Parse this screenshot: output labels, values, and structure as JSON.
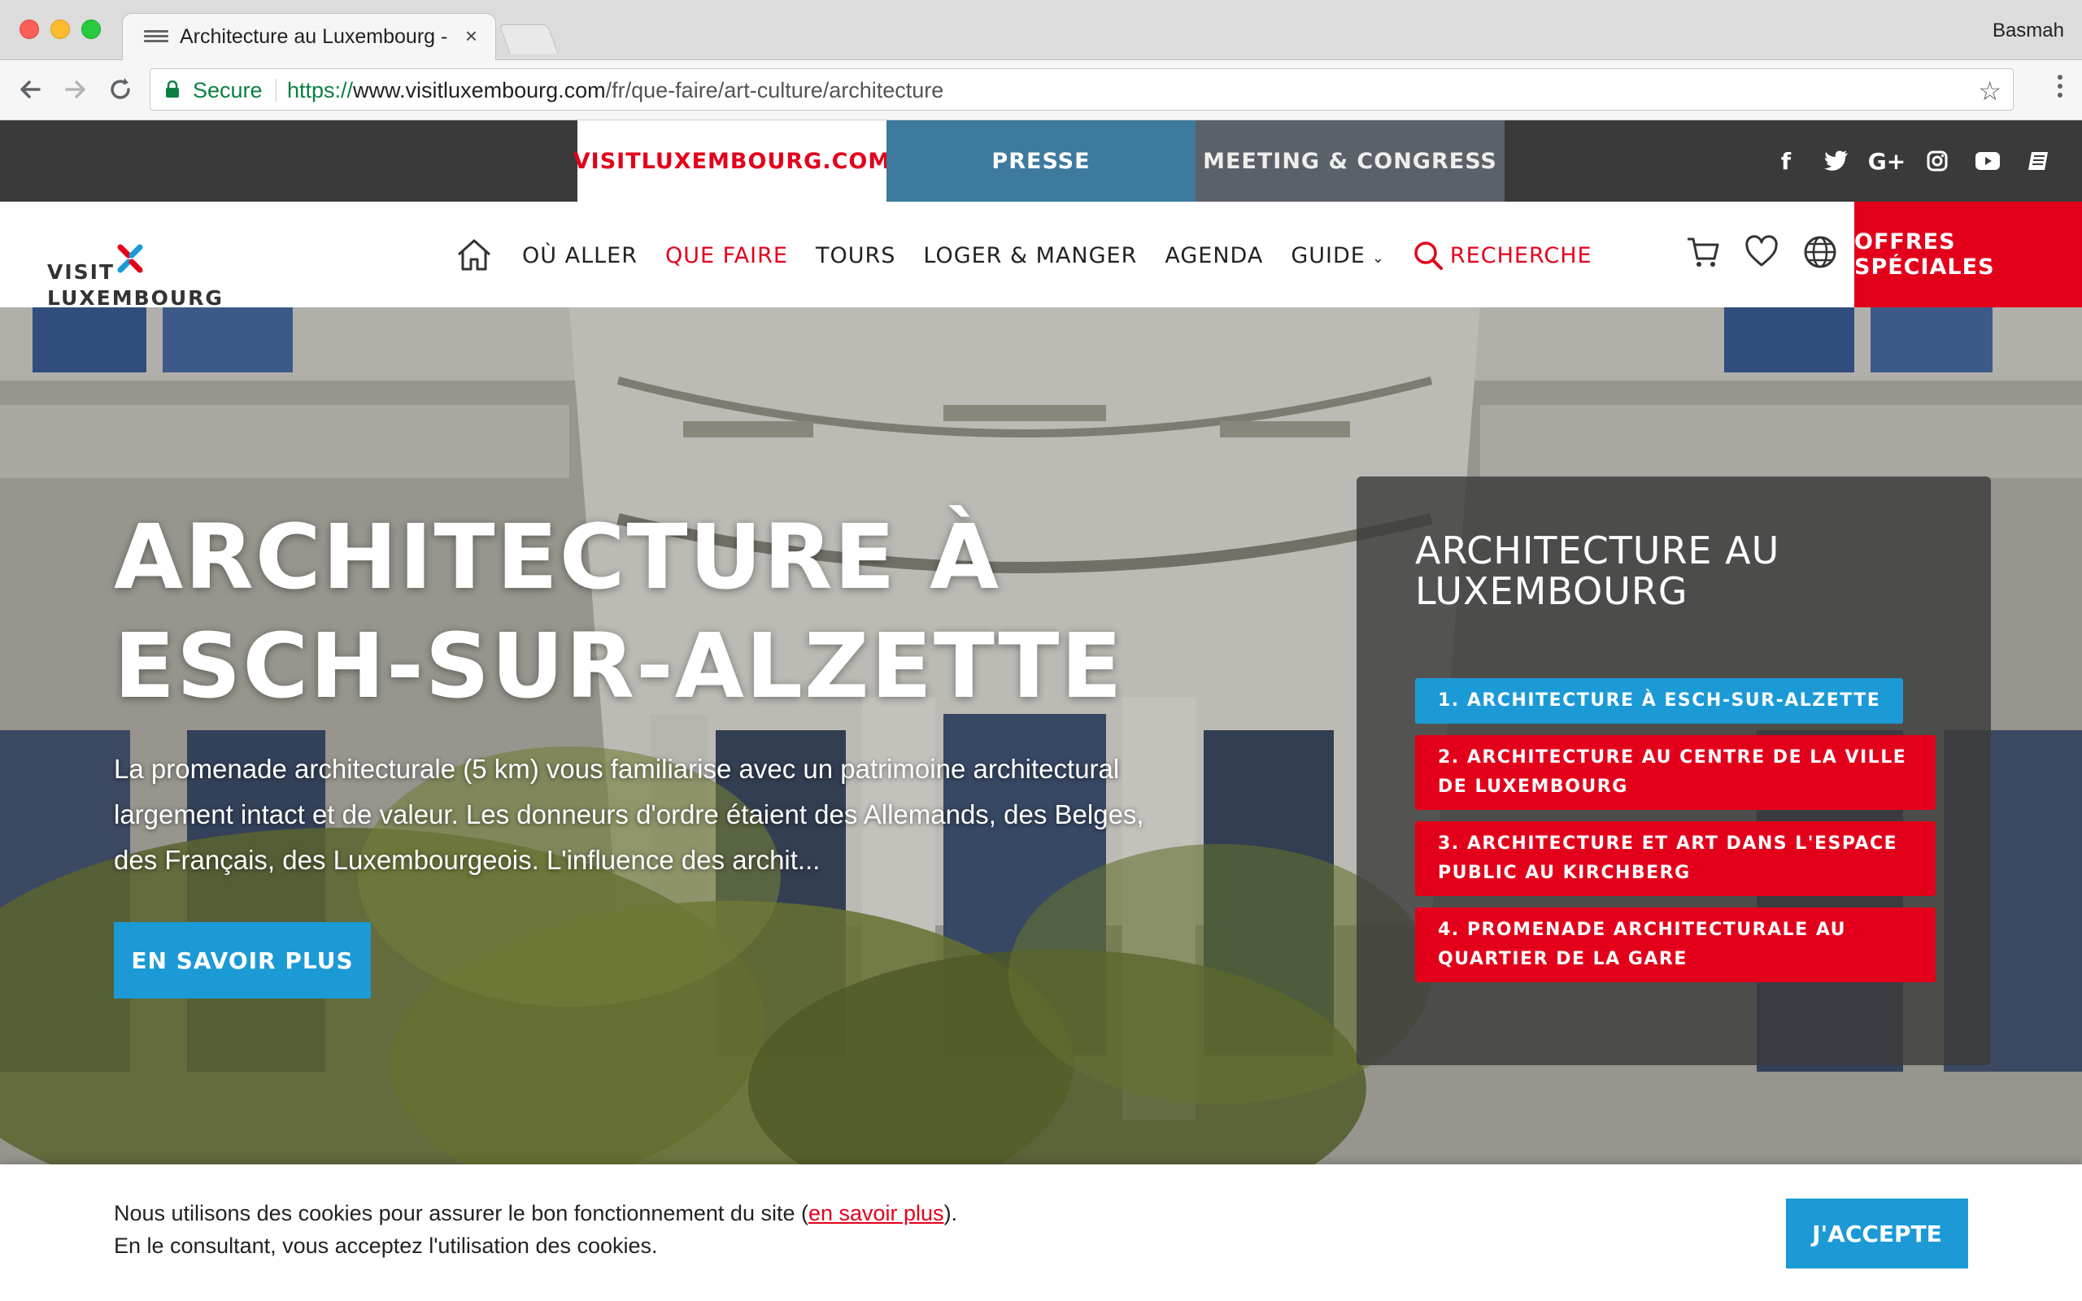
{
  "browser": {
    "tab_title": "Architecture au Luxembourg -",
    "tab_close": "×",
    "profile_name": "Basmah",
    "secure_label": "Secure",
    "url_scheme": "https://",
    "url_host": "www.visitluxembourg.com",
    "url_path": "/fr/que-faire/art-culture/architecture",
    "star_glyph": "☆"
  },
  "sitebar": {
    "tabs": [
      {
        "label": "VISITLUXEMBOURG.COM"
      },
      {
        "label": "PRESSE"
      },
      {
        "label": "MEETING & CONGRESS"
      }
    ],
    "social_icons": [
      "facebook-icon",
      "twitter-icon",
      "google-plus-icon",
      "instagram-icon",
      "youtube-icon",
      "book-icon"
    ],
    "social_glyphs": [
      "f",
      "t",
      "G+",
      "◎",
      "▶",
      "▤"
    ]
  },
  "nav": {
    "logo_line1": "VISIT",
    "logo_line2": "LUXEMBOURG",
    "items": [
      {
        "label": "OÙ ALLER"
      },
      {
        "label": "QUE FAIRE"
      },
      {
        "label": "TOURS"
      },
      {
        "label": "LOGER & MANGER"
      },
      {
        "label": "AGENDA"
      },
      {
        "label": "GUIDE"
      }
    ],
    "guide_chevron": "⌄",
    "search_label": "RECHERCHE",
    "offres_label": "OFFRES SPÉCIALES"
  },
  "hero": {
    "title": "ARCHITECTURE À ESCH-SUR-ALZETTE",
    "description": "La promenade architecturale (5 km) vous familiarise avec un patrimoine architectural largement intact et de valeur. Les donneurs d'ordre étaient des Allemands, des Belges, des Français, des Luxembourgeois. L'influence des archit...",
    "button_label": "EN SAVOIR PLUS"
  },
  "side_panel": {
    "title": "ARCHITECTURE AU LUXEMBOURG",
    "items": [
      {
        "label": "1. ARCHITECTURE À ESCH-SUR-ALZETTE"
      },
      {
        "label": "2. ARCHITECTURE AU CENTRE DE LA VILLE DE LUXEMBOURG"
      },
      {
        "label": "3. ARCHITECTURE ET ART DANS L'ESPACE PUBLIC AU KIRCHBERG"
      },
      {
        "label": "4. PROMENADE ARCHITECTURALE AU QUARTIER DE LA GARE"
      }
    ]
  },
  "cookie": {
    "line1_before": "Nous utilisons des cookies pour assurer le bon fonctionnement du site (",
    "link": "en savoir plus",
    "line1_after": ").",
    "line2": "En le consultant, vous acceptez l'utilisation des cookies.",
    "accept_label": "J'ACCEPTE"
  },
  "colors": {
    "brand_red": "#e3001b",
    "brand_blue": "#1b9ad6",
    "presse_blue": "#3e7a9e",
    "dark_bar": "#3a3a3a"
  }
}
